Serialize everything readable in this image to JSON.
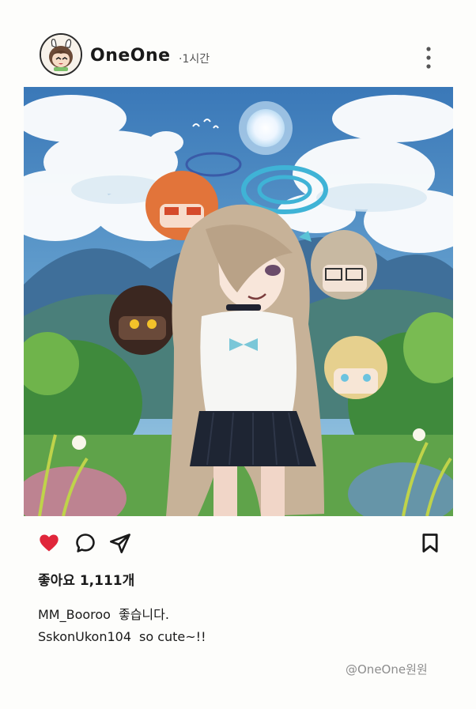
{
  "post": {
    "username": "OneOne",
    "time": "·1시간",
    "likes": "좋아요 1,111개",
    "comments": [
      {
        "user": "MM_Booroo",
        "text": "좋습니다."
      },
      {
        "user": "SskonUkon104",
        "text": "so cute~!!"
      }
    ],
    "watermark": "@OneOne원원"
  },
  "icons": {
    "avatar": "profile-avatar",
    "more": "more-vertical-icon",
    "like": "heart-filled-icon",
    "comment": "comment-bubble-icon",
    "share": "send-icon",
    "save": "bookmark-icon"
  },
  "colors": {
    "like": "#e0263a",
    "text": "#1a1a1a",
    "muted": "#8d8d8d",
    "background": "#fdfdfb"
  }
}
